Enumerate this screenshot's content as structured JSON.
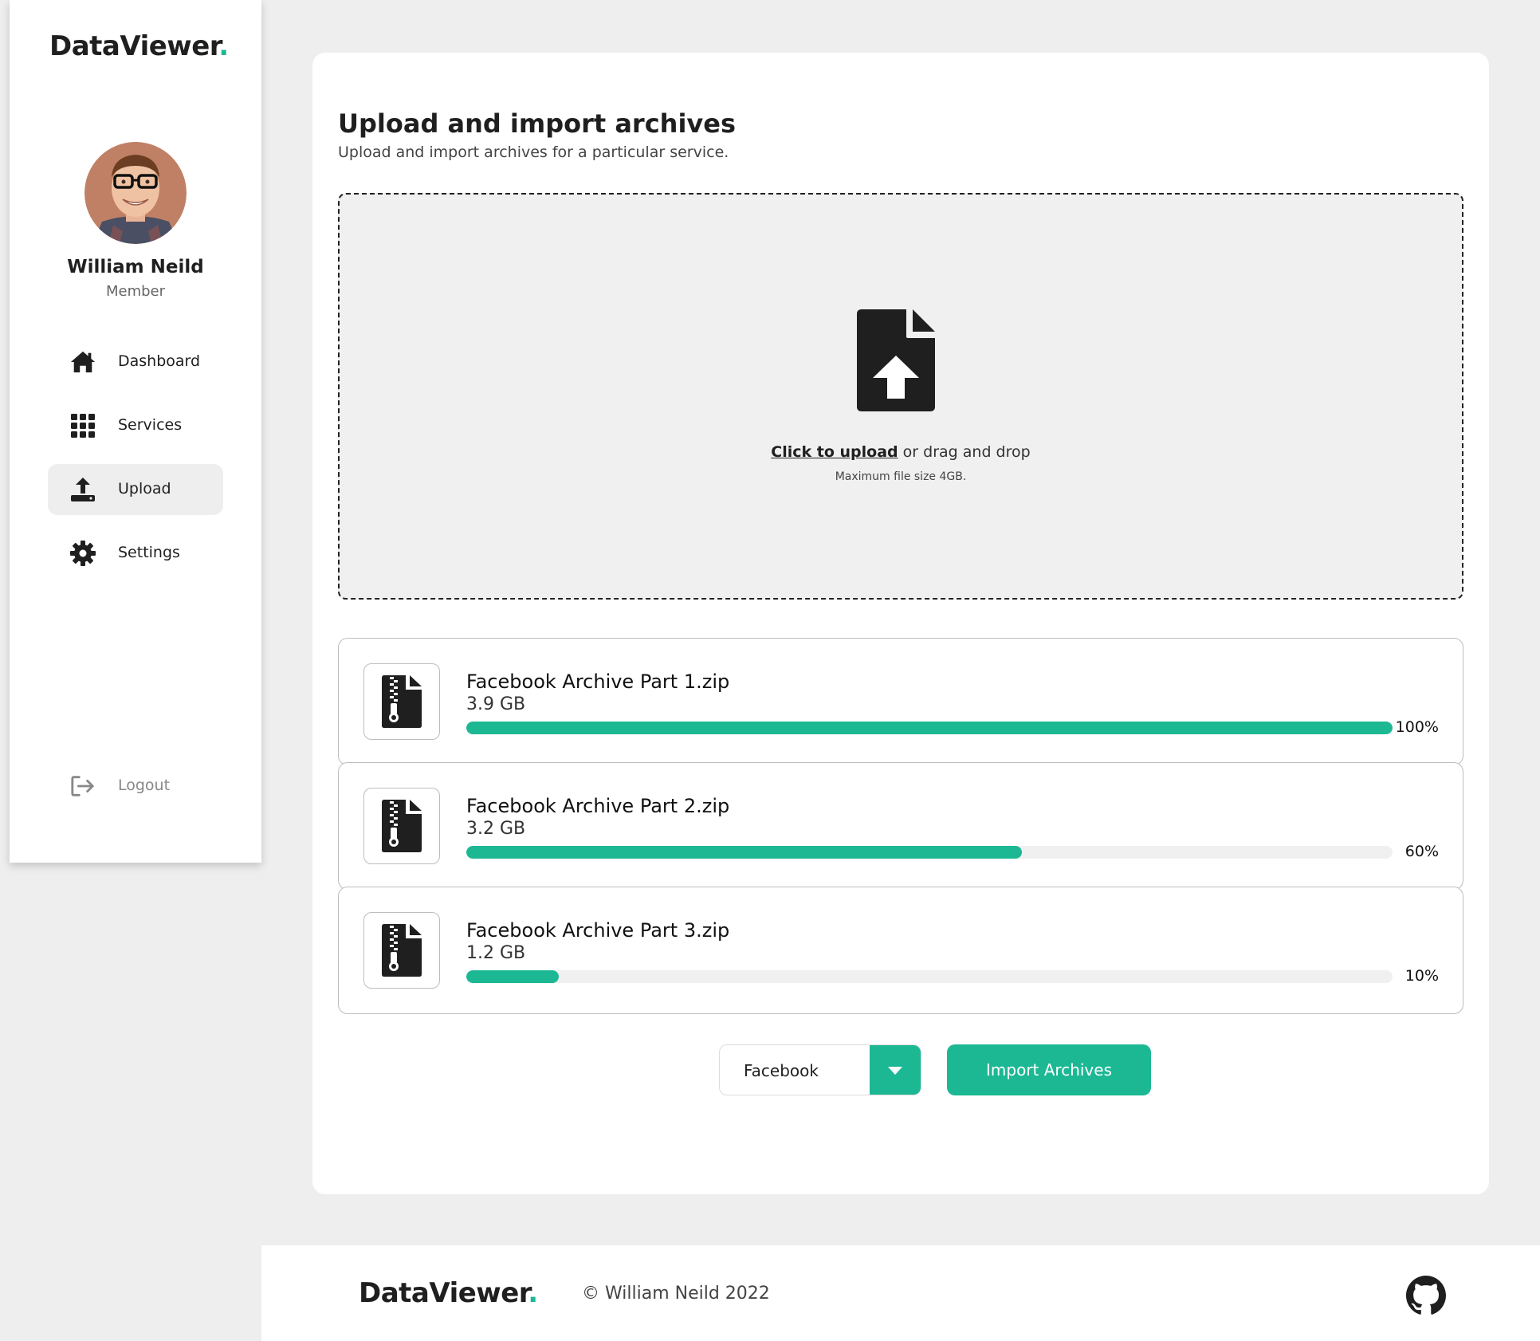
{
  "app": {
    "logo_text": "DataViewer",
    "logo_dot": "."
  },
  "user": {
    "name": "William Neild",
    "role": "Member"
  },
  "sidebar": {
    "items": [
      {
        "label": "Dashboard",
        "icon": "home-icon",
        "active": false
      },
      {
        "label": "Services",
        "icon": "grid-icon",
        "active": false
      },
      {
        "label": "Upload",
        "icon": "upload-icon",
        "active": true
      },
      {
        "label": "Settings",
        "icon": "gear-icon",
        "active": false
      }
    ],
    "logout_label": "Logout"
  },
  "main": {
    "title": "Upload and import archives",
    "subtitle": "Upload and import archives for a particular service.",
    "dropzone": {
      "click_text": "Click to upload",
      "rest_text": " or drag and drop",
      "hint": "Maximum file size 4GB."
    },
    "files": [
      {
        "name": "Facebook Archive Part 1.zip",
        "size": "3.9 GB",
        "progress": 100,
        "progress_label": "100%"
      },
      {
        "name": "Facebook Archive Part 2.zip",
        "size": "3.2 GB",
        "progress": 60,
        "progress_label": "60%"
      },
      {
        "name": "Facebook Archive Part 3.zip",
        "size": "1.2 GB",
        "progress": 10,
        "progress_label": "10%"
      }
    ],
    "service_select": {
      "value": "Facebook"
    },
    "import_button": "Import Archives"
  },
  "footer": {
    "logo_text": "DataViewer",
    "logo_dot": ".",
    "copyright": "© William Neild 2022"
  },
  "colors": {
    "accent": "#1cb894",
    "background": "#eeeeee",
    "card": "#ffffff",
    "text": "#1f1f1f"
  }
}
